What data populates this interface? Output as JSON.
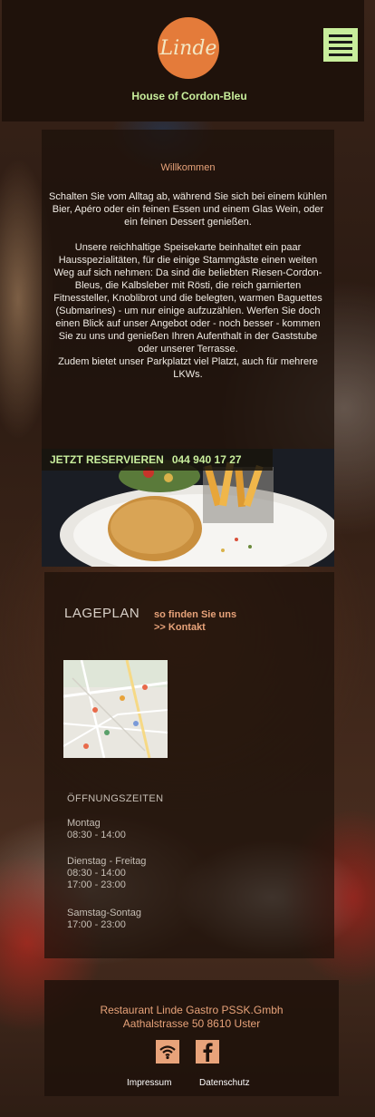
{
  "header": {
    "logo_text": "Linde",
    "tagline": "House of Cordon-Bleu"
  },
  "welcome": {
    "title": "Willkommen",
    "paragraph1": "Schalten Sie vom Alltag ab, während Sie sich bei einem kühlen Bier, Apéro oder ein feinen Essen und einem Glas Wein, oder ein feinen Dessert genießen.",
    "paragraph2": "Unsere reichhaltige Speisekarte beinhaltet ein paar Hausspezialitäten, für die einige Stammgäste einen weiten Weg auf sich nehmen: Da sind die beliebten Riesen-Cordon-Bleus, die Kalbsleber mit Rösti, die reich garnierten Fitnessteller, Knoblibrot und die belegten, warmen Baguettes (Submarines) - um nur einige aufzuzählen. Werfen Sie doch einen Blick auf unser Angebot oder - noch besser - kommen Sie zu uns und genießen Ihren Aufenthalt in der Gaststube oder unserer Terrasse.",
    "paragraph3": "Zudem bietet unser Parkplatzt viel Platzt, auch für mehrere  LKWs."
  },
  "promo": {
    "reserve_label": "JETZT RESERVIEREN",
    "phone": "044 940 17 27"
  },
  "location": {
    "title": "LAGEPLAN",
    "link_line1": "so finden Sie uns",
    "link_line2": ">> Kontakt"
  },
  "hours": {
    "title": "ÖFFNUNGSZEITEN",
    "groups": [
      {
        "days": "Montag",
        "times": [
          "08:30 - 14:00"
        ]
      },
      {
        "days": "Dienstag - Freitag",
        "times": [
          "08:30 - 14:00",
          "17:00 - 23:00"
        ]
      },
      {
        "days": "Samstag-Sontag",
        "times": [
          "17:00 - 23:00"
        ]
      }
    ]
  },
  "footer": {
    "address_line1": "Restaurant Linde Gastro PSSK.Gmbh",
    "address_line2": "Aathalstrasse 50 8610 Uster",
    "impressum": "Impressum",
    "datenschutz": "Datenschutz",
    "icons": [
      "wifi-icon",
      "facebook-icon"
    ]
  },
  "colors": {
    "accent_green": "#c8ee9c",
    "accent_orange": "#e8a37a",
    "logo_orange": "#e47b3a",
    "panel_dark": "#1f120b"
  }
}
